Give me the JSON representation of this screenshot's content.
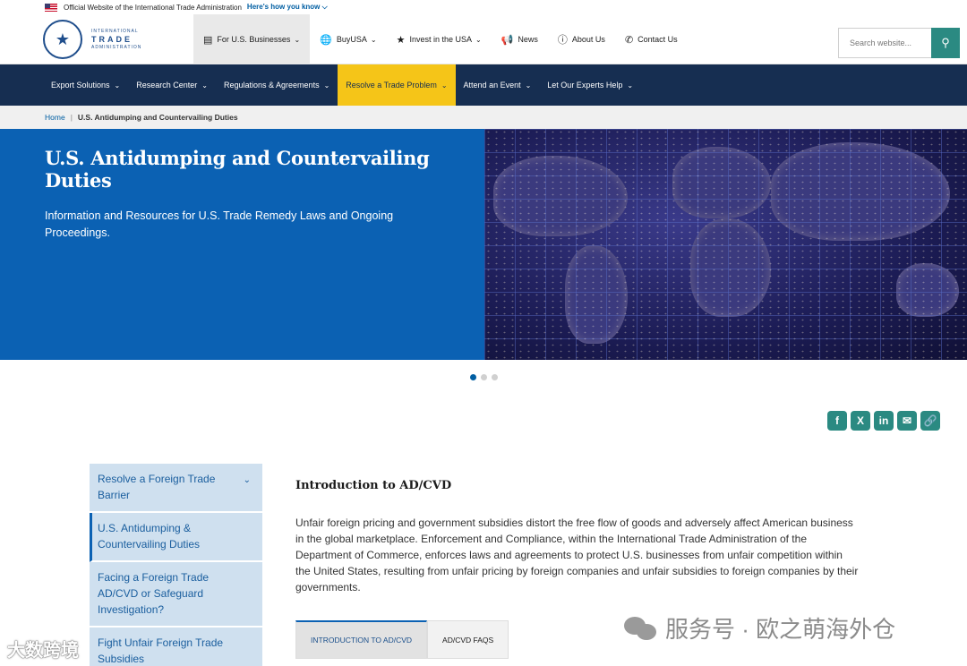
{
  "gov_banner": {
    "text": "Official Website of the International Trade Administration",
    "link": "Here's how you know ⌵"
  },
  "logo": {
    "small_top": "INTERNATIONAL",
    "big": "TRADE",
    "small_bottom": "ADMINISTRATION"
  },
  "top_nav": [
    {
      "label": "For U.S. Businesses",
      "icon": "business-icon"
    },
    {
      "label": "BuyUSA",
      "icon": "globe-icon"
    },
    {
      "label": "Invest in the USA",
      "icon": "star-icon"
    },
    {
      "label": "News",
      "icon": "megaphone-icon"
    },
    {
      "label": "About Us",
      "icon": "info-icon"
    },
    {
      "label": "Contact Us",
      "icon": "phone-icon"
    }
  ],
  "search": {
    "placeholder": "Search website..."
  },
  "main_nav": [
    {
      "label": "Export Solutions"
    },
    {
      "label": "Research Center"
    },
    {
      "label": "Regulations & Agreements"
    },
    {
      "label": "Resolve a Trade Problem"
    },
    {
      "label": "Attend an Event"
    },
    {
      "label": "Let Our Experts Help"
    }
  ],
  "breadcrumb": {
    "home": "Home",
    "sep": "|",
    "current": "U.S. Antidumping and Countervailing Duties"
  },
  "hero": {
    "title": "U.S. Antidumping and Countervailing Duties",
    "subtitle": "Information and Resources for U.S. Trade Remedy Laws and Ongoing Proceedings."
  },
  "share": [
    "facebook-icon",
    "x-icon",
    "linkedin-icon",
    "email-icon",
    "copy-link-icon"
  ],
  "sidebar": [
    {
      "label": "Resolve a Foreign Trade Barrier"
    },
    {
      "label": "U.S. Antidumping & Countervailing Duties"
    },
    {
      "label": "Facing a Foreign Trade AD/CVD or Safeguard Investigation?"
    },
    {
      "label": "Fight Unfair Foreign Trade Subsidies"
    }
  ],
  "content": {
    "title": "Introduction to AD/CVD",
    "body": "Unfair foreign pricing and government subsidies distort the free flow of goods and adversely affect American business in the global marketplace. Enforcement and Compliance, within the International Trade Administration of the Department of Commerce, enforces laws and agreements to protect U.S. businesses from unfair competition within the United States, resulting from unfair pricing by foreign companies and unfair subsidies to foreign companies by their governments.",
    "tabs": [
      {
        "label": "INTRODUCTION TO AD/CVD"
      },
      {
        "label": "AD/CVD FAQS"
      }
    ]
  },
  "watermarks": {
    "right": "服务号 · 欧之萌海外仓",
    "left": "大数跨境"
  }
}
